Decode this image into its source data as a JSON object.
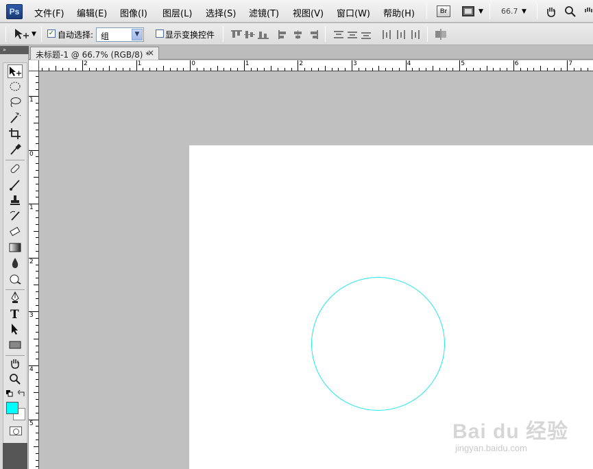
{
  "app": {
    "logo_text": "Ps"
  },
  "menu": [
    "文件(F)",
    "编辑(E)",
    "图像(I)",
    "图层(L)",
    "选择(S)",
    "滤镜(T)",
    "视图(V)",
    "窗口(W)",
    "帮助(H)"
  ],
  "appbar": {
    "bridge_label": "Br",
    "zoom": "66.7"
  },
  "options": {
    "auto_select_label": "自动选择:",
    "auto_select_checked": true,
    "auto_select_value": "组",
    "show_transform_label": "显示变换控件"
  },
  "document": {
    "tab_title": "未标题-1 @ 66.7% (RGB/8) *",
    "close_glyph": "×"
  },
  "colors": {
    "foreground": "#00ffff",
    "background": "#ffffff",
    "circle_stroke": "#1fe8ee"
  },
  "ruler_top_labels": [
    "2",
    "1",
    "0",
    "1",
    "2",
    "3",
    "4",
    "5",
    "6",
    "7"
  ],
  "ruler_left_labels": [
    "1",
    "0",
    "1",
    "2",
    "3",
    "4",
    "5"
  ],
  "tools": [
    "move-tool-icon",
    "marquee-ellipse-icon",
    "lasso-icon",
    "magic-wand-icon",
    "crop-icon",
    "eyedropper-icon",
    "healing-brush-icon",
    "brush-icon",
    "clone-stamp-icon",
    "history-brush-icon",
    "eraser-icon",
    "gradient-icon",
    "blur-icon",
    "dodge-icon",
    "pen-icon",
    "type-icon",
    "path-selection-icon",
    "rectangle-shape-icon",
    "hand-icon",
    "zoom-icon"
  ],
  "watermark": {
    "brand": "Bai du 经验",
    "url": "jingyan.baidu.com"
  }
}
